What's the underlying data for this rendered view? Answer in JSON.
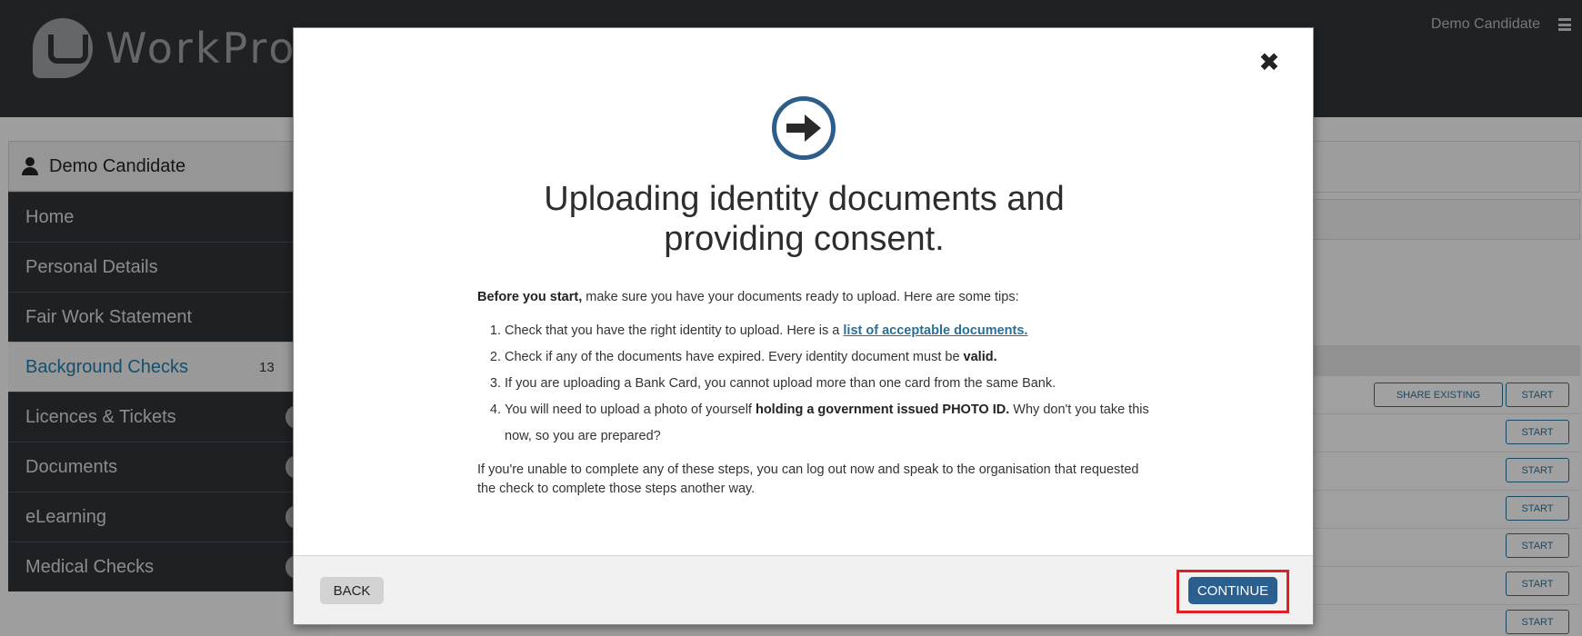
{
  "header": {
    "logo_text": "WorkPro",
    "user_name": "Demo Candidate",
    "menu_icon": "hamburger-icon"
  },
  "sidebar": {
    "user_name": "Demo Candidate",
    "items": [
      {
        "label": "Home"
      },
      {
        "label": "Personal Details"
      },
      {
        "label": "Fair Work Statement"
      },
      {
        "label": "Background Checks",
        "count": "13",
        "active": true
      },
      {
        "label": "Licences & Tickets"
      },
      {
        "label": "Documents"
      },
      {
        "label": "eLearning"
      },
      {
        "label": "Medical Checks"
      }
    ]
  },
  "main": {
    "share_existing_label": "SHARE EXISTING",
    "start_label": "START"
  },
  "modal": {
    "icon": "arrow-right-circle-icon",
    "title_line1": "Uploading identity documents and",
    "title_line2": "providing consent.",
    "intro_bold": "Before you start,",
    "intro_rest": " make sure you have your documents ready to upload. Here are some tips:",
    "tips": {
      "t1_text": "Check that you have the right identity to upload. Here is a ",
      "t1_link": "list of acceptable documents.",
      "t2_text": "Check if any of the documents have expired. Every identity document must be ",
      "t2_bold": "valid.",
      "t3_text": "If you are uploading a Bank Card, you cannot upload more than one card from the same Bank.",
      "t4_text": "You will need to upload a photo of yourself ",
      "t4_bold": "holding a government issued PHOTO ID.",
      "t4_rest": " Why don't you take this now, so you are prepared?"
    },
    "footer_text": "If you're unable to complete any of these steps, you can log out now and speak to the organisation that requested the check to complete those steps another way.",
    "back_label": "BACK",
    "continue_label": "CONTINUE",
    "colors": {
      "primary": "#2a5f8f",
      "highlight": "#e01f26",
      "link": "#2a6f95"
    }
  }
}
